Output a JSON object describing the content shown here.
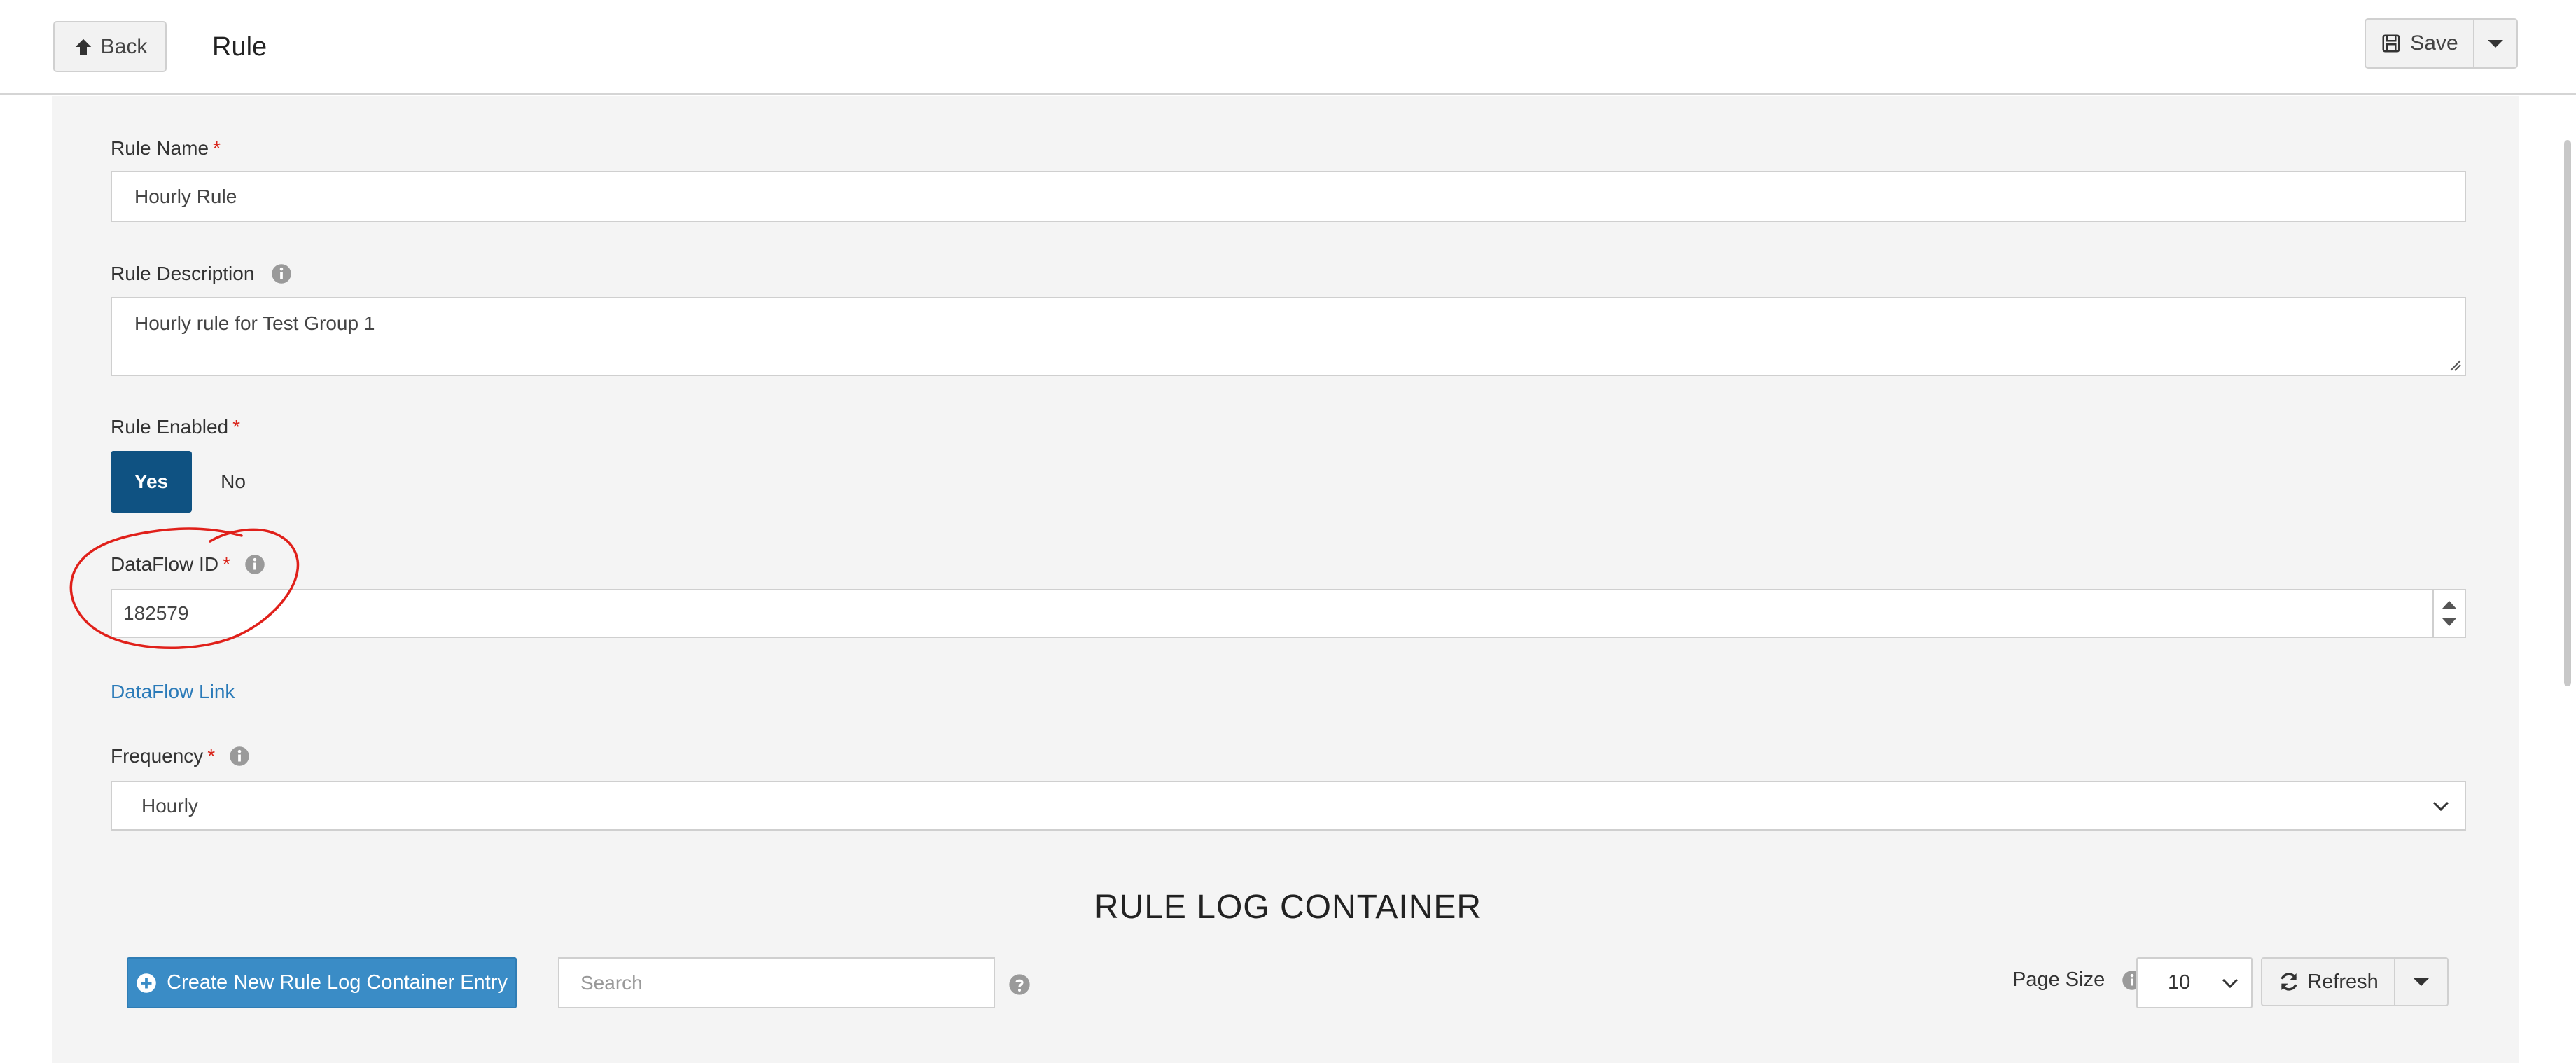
{
  "header": {
    "back_label": "Back",
    "title": "Rule",
    "save_label": "Save"
  },
  "form": {
    "rule_name": {
      "label": "Rule Name",
      "required_mark": "*",
      "value": "Hourly Rule"
    },
    "rule_description": {
      "label": "Rule Description",
      "value": "Hourly rule for Test Group 1"
    },
    "rule_enabled": {
      "label": "Rule Enabled",
      "required_mark": "*",
      "options": [
        "Yes",
        "No"
      ],
      "selected": "Yes"
    },
    "dataflow_id": {
      "label": "DataFlow ID",
      "required_mark": "*",
      "value": "182579"
    },
    "dataflow_link": "DataFlow Link",
    "frequency": {
      "label": "Frequency",
      "required_mark": "*",
      "value": "Hourly"
    }
  },
  "log_section": {
    "title": "RULE LOG CONTAINER",
    "create_label": "Create New Rule Log Container Entry",
    "search_placeholder": "Search",
    "page_size_label": "Page Size",
    "page_size_value": "10",
    "refresh_label": "Refresh"
  },
  "colors": {
    "primary_dark": "#0f5282",
    "primary": "#3a8cc6",
    "link": "#2a7ab8",
    "required": "#d9261c",
    "annotation": "#e0201a",
    "panel_bg": "#f4f4f4"
  },
  "icons": [
    "arrow-up-icon",
    "floppy-disk-icon",
    "caret-down-icon",
    "info-icon",
    "plus-circle-icon",
    "question-circle-icon",
    "refresh-icon",
    "chevron-down-icon",
    "spinner-up-icon",
    "spinner-down-icon"
  ]
}
